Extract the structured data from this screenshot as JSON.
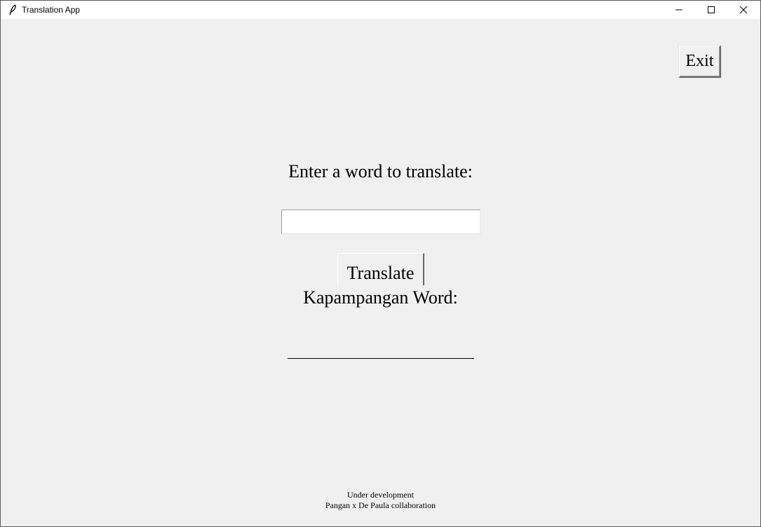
{
  "window": {
    "title": "Translation App",
    "icon": "feather-icon",
    "controls": {
      "minimize": "minimize-icon",
      "maximize": "maximize-icon",
      "close": "close-icon"
    }
  },
  "main": {
    "exit_label": "Exit",
    "prompt_label": "Enter a word to translate:",
    "input_value": "",
    "translate_label": "Translate",
    "result_label": "Kapampangan Word:",
    "result_value": ""
  },
  "footer": {
    "line1": "Under development",
    "line2": "Pangan x De Paula collaboration"
  }
}
